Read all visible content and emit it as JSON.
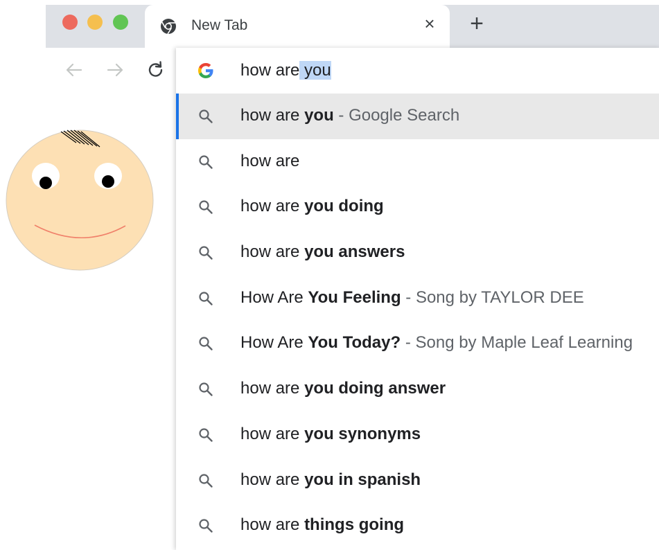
{
  "window": {
    "traffic_lights": {
      "close_color": "#ed6a5e",
      "minimize_color": "#f5bf4f",
      "zoom_color": "#61c554"
    }
  },
  "tab": {
    "title": "New Tab",
    "favicon": "chrome-icon",
    "close_icon": "close-icon"
  },
  "new_tab_icon": "plus-icon",
  "nav": {
    "back_icon": "back-arrow-icon",
    "forward_icon": "forward-arrow-icon",
    "reload_icon": "reload-icon"
  },
  "omnibox": {
    "icon": "google-g-icon",
    "typed_text": "how are",
    "autocomplete_text": " you",
    "accent_color": "#1a73e8"
  },
  "suggestions": [
    {
      "plain": "how are ",
      "bold": "you",
      "separator": " - ",
      "description": "Google Search",
      "highlighted": true
    },
    {
      "plain": "how are",
      "bold": "",
      "separator": "",
      "description": ""
    },
    {
      "plain": "how are ",
      "bold": "you doing",
      "separator": "",
      "description": ""
    },
    {
      "plain": "how are ",
      "bold": "you answers",
      "separator": "",
      "description": ""
    },
    {
      "plain": "How Are ",
      "bold": "You Feeling",
      "separator": " - ",
      "description": "Song by TAYLOR DEE"
    },
    {
      "plain": "How Are ",
      "bold": "You Today?",
      "separator": " - ",
      "description": "Song by Maple Leaf Learning"
    },
    {
      "plain": "how are ",
      "bold": "you doing answer",
      "separator": "",
      "description": ""
    },
    {
      "plain": "how are ",
      "bold": "you synonyms",
      "separator": "",
      "description": ""
    },
    {
      "plain": "how are ",
      "bold": "you in spanish",
      "separator": "",
      "description": ""
    },
    {
      "plain": "how are ",
      "bold": "things going",
      "separator": "",
      "description": ""
    }
  ],
  "page_illustration": {
    "name": "smiley-face-drawing",
    "fill_color": "#fde0b4",
    "smile_color": "#f0806a"
  }
}
